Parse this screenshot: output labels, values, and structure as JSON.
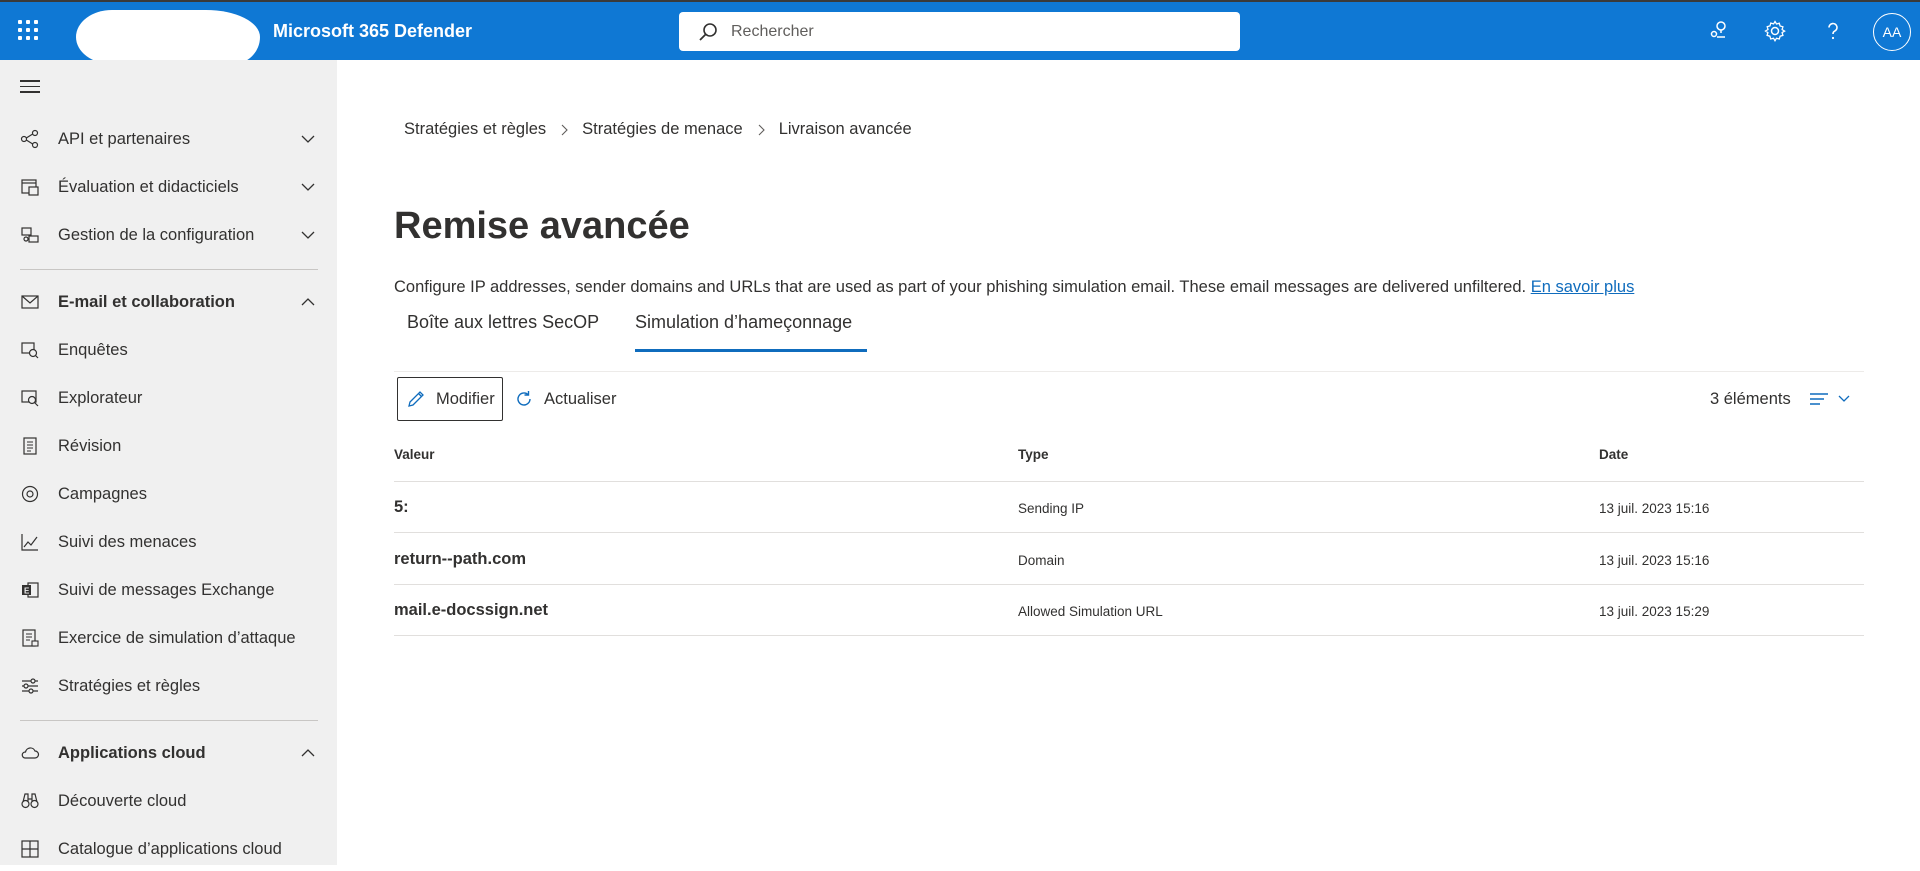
{
  "app": {
    "title": "Microsoft 365 Defender"
  },
  "search": {
    "placeholder": "Rechercher"
  },
  "user": {
    "initials": "AA"
  },
  "sidebar": {
    "items": [
      {
        "label": "API et partenaires",
        "icon": "api-partners-icon",
        "expanded": false
      },
      {
        "label": "Évaluation et didacticiels",
        "icon": "evaluation-icon",
        "expanded": false
      },
      {
        "label": "Gestion de la configuration",
        "icon": "configuration-icon",
        "expanded": false
      },
      {
        "label": "E-mail et collaboration",
        "icon": "mail-icon",
        "expanded": true
      },
      {
        "label": "Enquêtes",
        "icon": "investigations-icon"
      },
      {
        "label": "Explorateur",
        "icon": "explorer-icon"
      },
      {
        "label": "Révision",
        "icon": "review-icon"
      },
      {
        "label": "Campagnes",
        "icon": "campaigns-icon"
      },
      {
        "label": "Suivi des menaces",
        "icon": "threat-tracker-icon"
      },
      {
        "label": "Suivi de messages Exchange",
        "icon": "exchange-icon"
      },
      {
        "label": "Exercice de simulation d’attaque",
        "icon": "attack-simulation-icon"
      },
      {
        "label": "Stratégies et règles",
        "icon": "policies-icon"
      },
      {
        "label": "Applications cloud",
        "icon": "cloud-icon",
        "expanded": true
      },
      {
        "label": "Découverte cloud",
        "icon": "binoculars-icon"
      },
      {
        "label": "Catalogue d’applications cloud",
        "icon": "catalog-icon"
      }
    ]
  },
  "breadcrumb": [
    "Stratégies et règles",
    "Stratégies de menace",
    "Livraison avancée"
  ],
  "page": {
    "title": "Remise avancée",
    "description": "Configure IP addresses, sender domains and URLs that are used as part of your phishing simulation email. These email messages are delivered unfiltered.",
    "learn_more": "En savoir plus"
  },
  "tabs": [
    {
      "label": "Boîte aux lettres SecOP",
      "active": false
    },
    {
      "label": "Simulation d’hameçonnage",
      "active": true
    }
  ],
  "toolbar": {
    "edit_label": "Modifier",
    "refresh_label": "Actualiser",
    "count": "3 éléments"
  },
  "table": {
    "headers": [
      "Valeur",
      "Type",
      "Date"
    ],
    "rows": [
      {
        "value": "5:",
        "type": "Sending IP",
        "date": "13 juil. 2023 15:16"
      },
      {
        "value": "return--path.com",
        "type": "Domain",
        "date": "13 juil. 2023 15:16"
      },
      {
        "value": "mail.e-docssign.net",
        "type": "Allowed Simulation URL",
        "date": "13 juil. 2023 15:29"
      }
    ]
  },
  "colors": {
    "header_bg": "#0f78d4",
    "sidebar_bg": "#f0f0f0",
    "accent": "#0f6cbd"
  }
}
